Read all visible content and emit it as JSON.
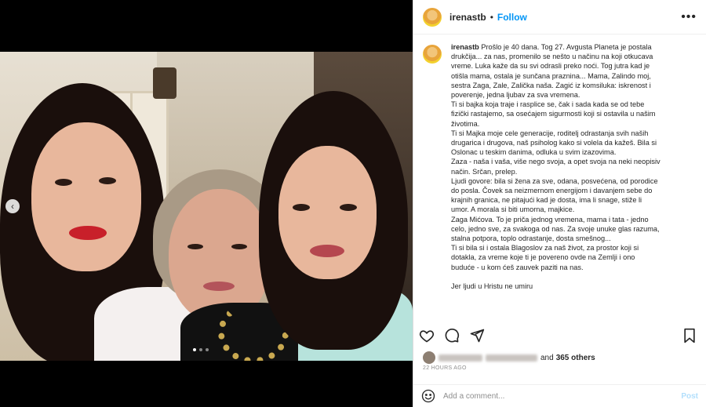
{
  "header": {
    "username": "irenastb",
    "separator": "•",
    "follow_label": "Follow",
    "more_icon": "more-options-icon"
  },
  "caption": {
    "username": "irenastb",
    "text": "Prošlo je 40 dana. Tog 27. Avgusta Planeta je postala\ndrukčija... za nas, promenilo se nešto u načinu na koji otkucava\nvreme. Luka kaže da su svi odrasli preko noći. Tog jutra kad je\notišla mama, ostala je sunčana praznina... Mama, Zalindo moj,\nsestra Zaga, Zale, Zalička naša. Zagić iz komsiluka: iskrenost i\npoverenje, jedna ljubav za sva vremena.\nTi si bajka koja traje i rasplice se, čak i sada kada se od tebe\nfizički rastajemo, sa osećajem sigurmosti koji si ostavila u našim\nživotima.\nTi si Majka moje cele generacije, roditelj odrastanja svih naših\ndrugarica i drugova, naš psiholog kako si volela da kažeš. Bila si\nOslonac u teskim danima, odluka u svim izazovima.\nZaza - naša i vaša, više nego svoja, a opet svoja na neki neopisiv\nnačin. Srčan, prelep.\nLjudi govore: bila si žena za sve, odana, posvećena, od porodice\ndo posla. Čovek sa neizmernom energijom i davanjem sebe do\nkrajnih granica, ne pitajući kad je dosta, ima li snage, stiže li\numor. A morala si biti umorna, majkice.\nZaga Mićova. To je priča jednog vremena, mama i tata - jedno\ncelo, jedno sve, za svakoga od nas. Za svoje unuke glas razuma,\nstalna potpora, toplo odrastanje, dosta smešnog...\nTi si bila si i ostala Blagoslov za naš život, za prostor koji si\ndotakla, za vreme koje ti je povereno ovde na Zemlji i ono\nbuduće - u kom ćeš zauvek paziti na nas.\n\nJer ljudi u Hristu ne umiru"
  },
  "actions": {
    "like_icon": "heart-icon",
    "comment_icon": "comment-icon",
    "share_icon": "share-icon",
    "save_icon": "bookmark-icon"
  },
  "likes": {
    "and_text": "and",
    "count_text": "365 others"
  },
  "timestamp": "22 HOURS AGO",
  "comment": {
    "placeholder": "Add a comment...",
    "post_label": "Post"
  },
  "carousel": {
    "prev_icon": "chevron-left-icon",
    "prev_glyph": "‹",
    "total_slides": 3,
    "active_slide": 1
  },
  "colors": {
    "link_blue": "#0095f6",
    "post_disabled": "#b2dffc",
    "text": "#262626",
    "muted": "#8e8e8e"
  }
}
